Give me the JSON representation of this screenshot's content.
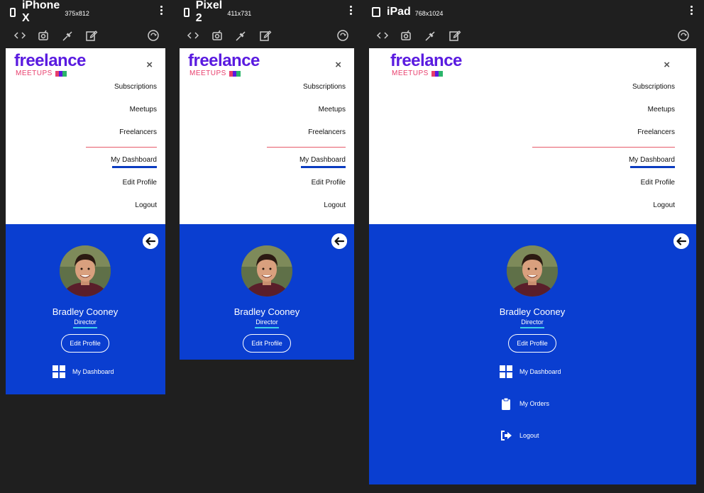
{
  "devices": [
    {
      "name": "iPhone X",
      "size": "375x812",
      "icon": "phone-icon"
    },
    {
      "name": "Pixel 2",
      "size": "411x731",
      "icon": "phone-icon"
    },
    {
      "name": "iPad",
      "size": "768x1024",
      "icon": "tablet-icon"
    }
  ],
  "toolbar_icons": [
    "code-icon",
    "camera-icon",
    "plug-icon",
    "edit-icon",
    "rotate-icon"
  ],
  "app": {
    "logo_main": "freelance",
    "logo_sub": "MEETUPS",
    "close": "×",
    "menu": {
      "subscriptions": "Subscriptions",
      "meetups": "Meetups",
      "freelancers": "Freelancers",
      "dashboard": "My Dashboard",
      "edit_profile": "Edit Profile",
      "logout": "Logout"
    },
    "profile": {
      "name": "Bradley Cooney",
      "role": "Director",
      "edit_button": "Edit Profile"
    },
    "panel_links": {
      "dashboard": "My Dashboard",
      "orders": "My Orders",
      "logout": "Logout"
    }
  },
  "colors": {
    "brand_purple": "#5a1be0",
    "brand_pink": "#e83e6c",
    "panel_blue": "#0a3ed0",
    "active_bar": "#0b3cc0",
    "accent_cyan": "#3fd0e8"
  }
}
